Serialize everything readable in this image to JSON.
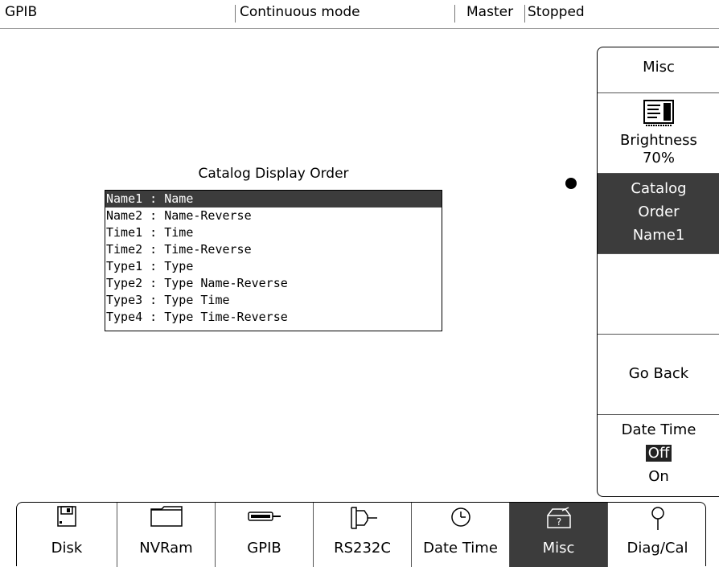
{
  "status_bar": {
    "interface": "GPIB",
    "mode": "Continuous mode",
    "role": "Master",
    "state": "Stopped"
  },
  "catalog": {
    "title": "Catalog Display Order",
    "items": [
      {
        "label": "Name1 : Name",
        "selected": true
      },
      {
        "label": "Name2 : Name-Reverse",
        "selected": false
      },
      {
        "label": "Time1 : Time",
        "selected": false
      },
      {
        "label": "Time2 : Time-Reverse",
        "selected": false
      },
      {
        "label": "Type1 : Type",
        "selected": false
      },
      {
        "label": "Type2 : Type Name-Reverse",
        "selected": false
      },
      {
        "label": "Type3 : Type Time",
        "selected": false
      },
      {
        "label": "Type4 : Type Time-Reverse",
        "selected": false
      }
    ]
  },
  "softkeys": {
    "header": "Misc",
    "brightness": {
      "label": "Brightness",
      "value": "70%",
      "icon": "brightness-icon"
    },
    "catalog_order": {
      "line1": "Catalog",
      "line2": "Order",
      "value": "Name1"
    },
    "empty": "",
    "go_back": "Go Back",
    "date_time": {
      "label": "Date Time",
      "off": "Off",
      "on": "On",
      "selected": "Off"
    }
  },
  "bottom_menu": [
    {
      "label": "Disk",
      "icon": "floppy-disk-icon",
      "selected": false
    },
    {
      "label": "NVRam",
      "icon": "folder-icon",
      "selected": false
    },
    {
      "label": "GPIB",
      "icon": "gpib-connector-icon",
      "selected": false
    },
    {
      "label": "RS232C",
      "icon": "serial-connector-icon",
      "selected": false
    },
    {
      "label": "Date Time",
      "icon": "clock-icon",
      "selected": false
    },
    {
      "label": "Misc",
      "icon": "misc-toolbox-icon",
      "selected": true
    },
    {
      "label": "Diag/Cal",
      "icon": "probe-icon",
      "selected": false
    }
  ],
  "colors": {
    "selected_background": "#3c3c3c",
    "selected_text": "#ffffff",
    "background": "#ffffff"
  }
}
